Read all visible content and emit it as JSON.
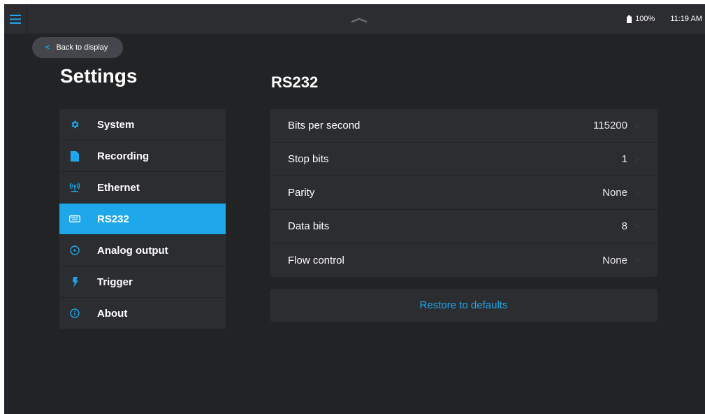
{
  "status": {
    "battery": "100%",
    "time": "11:19 AM"
  },
  "back_button": {
    "label": "Back to display"
  },
  "settings_title": "Settings",
  "section_title": "RS232",
  "nav": [
    {
      "label": "System",
      "icon": "gear-icon"
    },
    {
      "label": "Recording",
      "icon": "file-icon"
    },
    {
      "label": "Ethernet",
      "icon": "network-icon"
    },
    {
      "label": "RS232",
      "icon": "serial-port-icon",
      "active": true
    },
    {
      "label": "Analog output",
      "icon": "circle-dot-icon"
    },
    {
      "label": "Trigger",
      "icon": "lightning-icon"
    },
    {
      "label": "About",
      "icon": "info-icon"
    }
  ],
  "rows": [
    {
      "label": "Bits per second",
      "value": "115200"
    },
    {
      "label": "Stop bits",
      "value": "1"
    },
    {
      "label": "Parity",
      "value": "None"
    },
    {
      "label": "Data bits",
      "value": "8"
    },
    {
      "label": "Flow control",
      "value": "None"
    }
  ],
  "restore_button": {
    "label": "Restore to defaults"
  },
  "colors": {
    "accent": "#1ea7ea",
    "background": "#222325",
    "panel": "#2c2d30"
  }
}
